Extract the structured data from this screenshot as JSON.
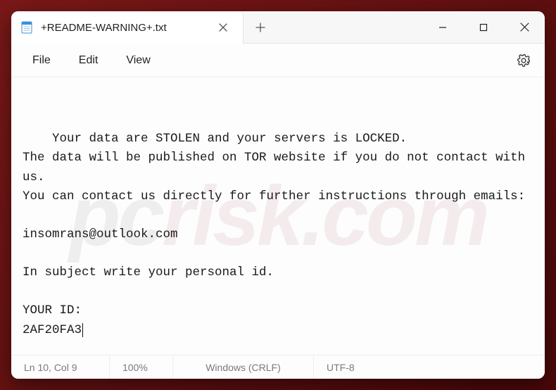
{
  "tab": {
    "title": "+README-WARNING+.txt"
  },
  "menu": {
    "file": "File",
    "edit": "Edit",
    "view": "View"
  },
  "document": {
    "lines": [
      "Your data are STOLEN and your servers is LOCKED.",
      "The data will be published on TOR website if you do not contact with us.",
      "You can contact us directly for further instructions through emails:",
      "",
      "insomrans@outlook.com",
      "",
      "In subject write your personal id.",
      "",
      "YOUR ID:",
      "2AF20FA3"
    ],
    "contact_email": "insomrans@outlook.com",
    "personal_id": "2AF20FA3"
  },
  "status": {
    "position": "Ln 10, Col 9",
    "zoom": "100%",
    "line_endings": "Windows (CRLF)",
    "encoding": "UTF-8"
  },
  "watermark": {
    "prefix": "pc",
    "suffix": "risk.com"
  }
}
